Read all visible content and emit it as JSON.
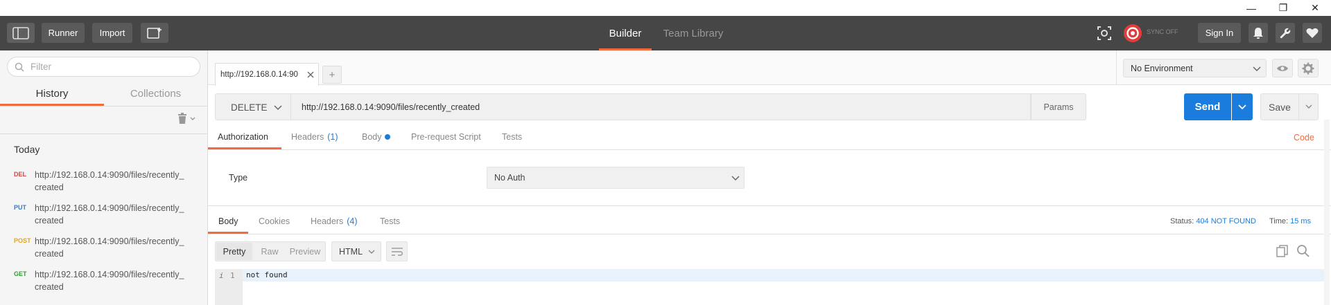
{
  "window": {
    "minimize_glyph": "—",
    "restore_glyph": "❐",
    "close_glyph": "✕"
  },
  "header": {
    "runner_label": "Runner",
    "import_label": "Import",
    "tabs": [
      {
        "label": "Builder",
        "active": true
      },
      {
        "label": "Team Library",
        "active": false
      }
    ],
    "sync_label": "SYNC OFF",
    "signin_label": "Sign In",
    "colors": {
      "bar": "#464646",
      "accent": "#f26b3a",
      "sync": "#e03d3d"
    }
  },
  "sidebar": {
    "filter_placeholder": "Filter",
    "tabs": [
      {
        "label": "History",
        "active": true
      },
      {
        "label": "Collections",
        "active": false
      }
    ],
    "group_label": "Today",
    "items": [
      {
        "method": "DEL",
        "color": "#e03d3d",
        "url_line1": "http://192.168.0.14:9090/files/recently_",
        "url_line2": "created"
      },
      {
        "method": "PUT",
        "color": "#2a7fd4",
        "url_line1": "http://192.168.0.14:9090/files/recently_",
        "url_line2": "created"
      },
      {
        "method": "POST",
        "color": "#f0a30a",
        "url_line1": "http://192.168.0.14:9090/files/recently_",
        "url_line2": "created"
      },
      {
        "method": "GET",
        "color": "#2ca02c",
        "url_line1": "http://192.168.0.14:9090/files/recently_",
        "url_line2": "created"
      }
    ]
  },
  "request": {
    "tab_label": "http://192.168.0.14:90",
    "add_tab_glyph": "+",
    "environment": "No Environment",
    "method": "DELETE",
    "url": "http://192.168.0.14:9090/files/recently_created",
    "params_label": "Params",
    "send_label": "Send",
    "save_label": "Save",
    "subtabs": [
      {
        "label": "Authorization",
        "active": true
      },
      {
        "label": "Headers",
        "count": "(1)"
      },
      {
        "label": "Body",
        "dot": true
      },
      {
        "label": "Pre-request Script"
      },
      {
        "label": "Tests"
      }
    ],
    "code_label": "Code",
    "auth_type_label": "Type",
    "auth_type_value": "No Auth"
  },
  "response": {
    "tabs": [
      {
        "label": "Body",
        "active": true
      },
      {
        "label": "Cookies"
      },
      {
        "label": "Headers",
        "count": "(4)"
      },
      {
        "label": "Tests"
      }
    ],
    "status_label": "Status:",
    "status_value": "404 NOT FOUND",
    "time_label": "Time:",
    "time_value": "15 ms",
    "view_modes": [
      "Pretty",
      "Raw",
      "Preview"
    ],
    "format": "HTML",
    "line_number": "1",
    "line_marker": "i",
    "body_text": "not found"
  }
}
